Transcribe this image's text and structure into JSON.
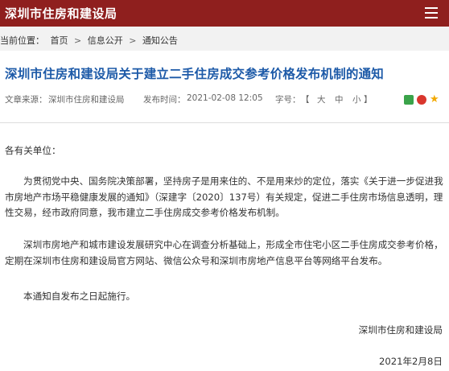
{
  "header": {
    "site_title": "深圳市住房和建设局",
    "menu_icon": "hamburger-menu-icon"
  },
  "breadcrumb": {
    "prefix": "当前位置：",
    "items": [
      "首页",
      "信息公开",
      "通知公告"
    ],
    "separator": ">"
  },
  "article": {
    "title": "深圳市住房和建设局关于建立二手住房成交参考价格发布机制的通知",
    "source_label": "文章来源：",
    "source_value": "深圳市住房和建设局",
    "time_label": "发布时间：",
    "time_value": "2021-02-08 12:05",
    "font_size_label": "字号：",
    "font_size_open": "【",
    "font_size_options": [
      "大",
      "中",
      "小"
    ],
    "font_size_close": "】",
    "share_icons": [
      "wechat-icon",
      "weibo-icon",
      "favorite-star-icon"
    ],
    "salutation": "各有关单位：",
    "paragraphs": [
      "为贯彻党中央、国务院决策部署，坚持房子是用来住的、不是用来炒的定位，落实《关于进一步促进我市房地产市场平稳健康发展的通知》（深建字〔2020〕137号）有关规定，促进二手住房市场信息透明，理性交易，经市政府同意，我市建立二手住房成交参考价格发布机制。",
      "深圳市房地产和城市建设发展研究中心在调查分析基础上，形成全市住宅小区二手住房成交参考价格，定期在深圳市住房和建设局官方网站、微信公众号和深圳市房地产信息平台等网络平台发布。",
      "本通知自发布之日起施行。"
    ],
    "signature": "深圳市住房和建设局",
    "date": "2021年2月8日"
  },
  "colors": {
    "header_bg": "#8f1f1e",
    "title_blue": "#1d5aa8",
    "breadcrumb_bg": "#f2f2f2"
  }
}
